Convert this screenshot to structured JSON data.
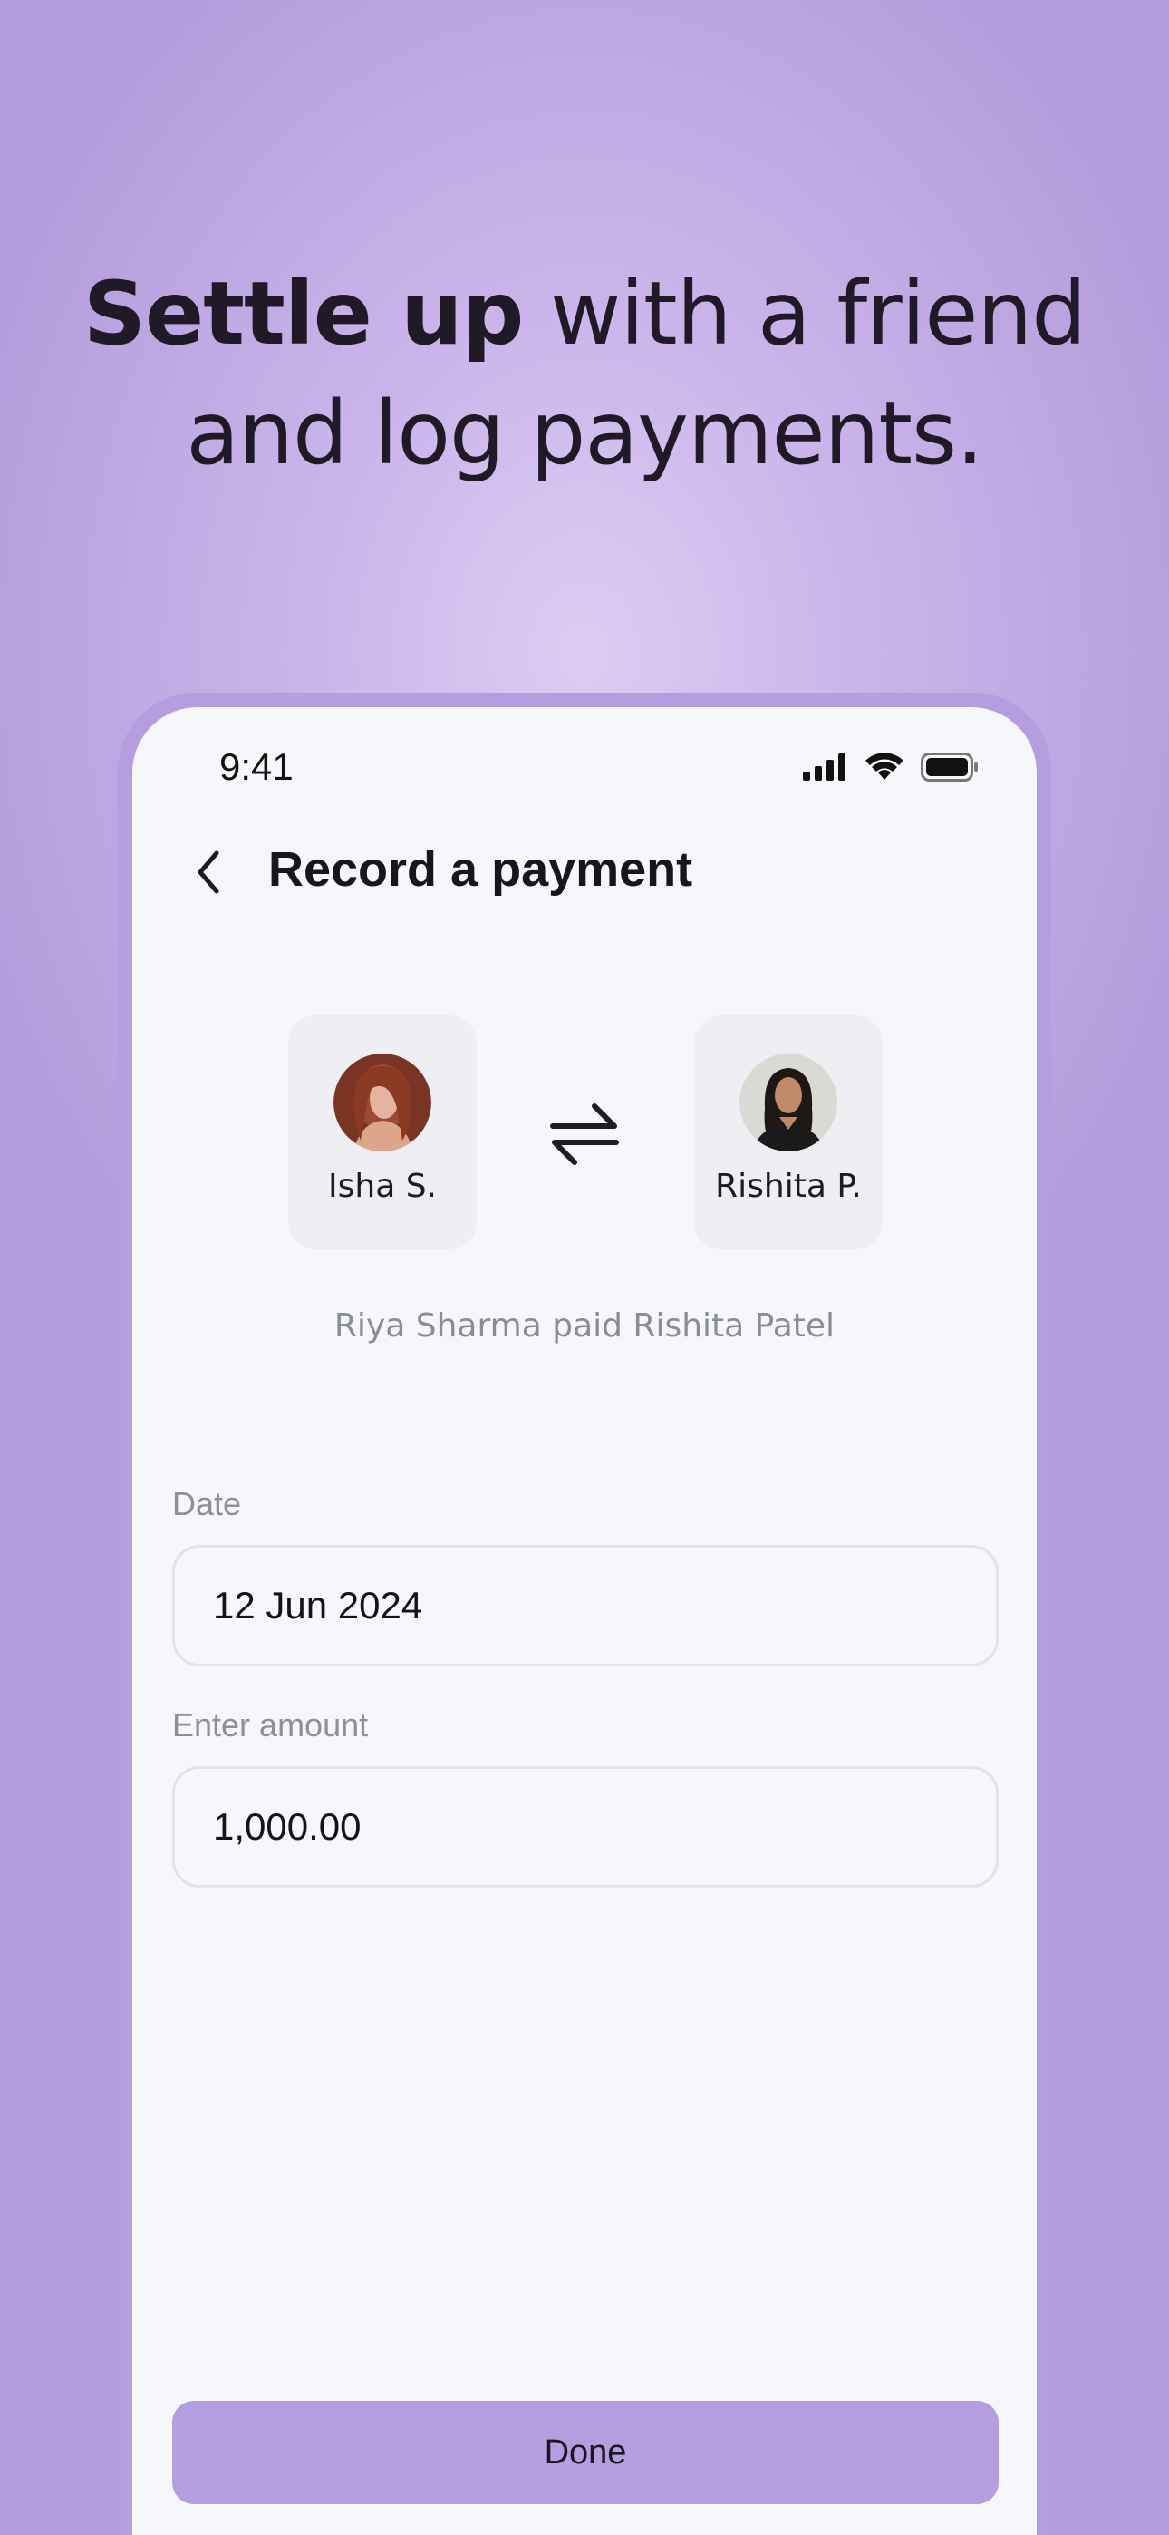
{
  "headline": {
    "bold": "Settle up",
    "rest_line1": " with a friend",
    "line2": "and log payments."
  },
  "status_bar": {
    "time": "9:41",
    "icons": [
      "cellular-signal-icon",
      "wifi-icon",
      "battery-icon"
    ]
  },
  "nav": {
    "title": "Record a payment",
    "back_icon": "chevron-left-icon"
  },
  "payer": {
    "name": "Isha S.",
    "avatar": "avatar-photo"
  },
  "payee": {
    "name": "Rishita P.",
    "avatar": "avatar-photo"
  },
  "swap_icon": "swap-arrows-icon",
  "summary": "Riya Sharma paid Rishita Patel",
  "form": {
    "date_label": "Date",
    "date_value": "12 Jun 2024",
    "amount_label": "Enter amount",
    "amount_value": "1,000.00"
  },
  "done_label": "Done",
  "colors": {
    "background": "#c9b4ea",
    "accent": "#b49ee0",
    "screen": "#f6f7fa",
    "text": "#17161b",
    "muted": "#8a8d93"
  }
}
